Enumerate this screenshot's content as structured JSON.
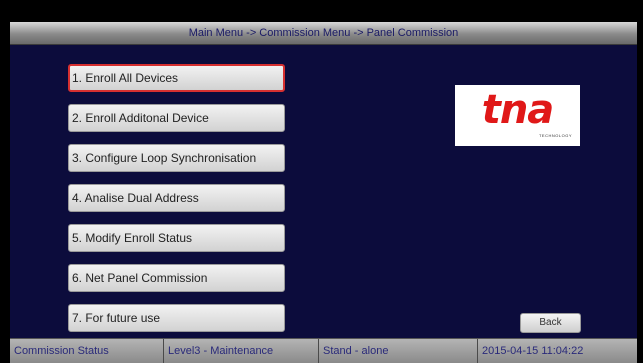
{
  "header": {
    "breadcrumb": "Main Menu -> Commission Menu -> Panel Commission"
  },
  "menu": {
    "items": [
      {
        "label": "1. Enroll All Devices"
      },
      {
        "label": "2. Enroll Additonal Device"
      },
      {
        "label": "3. Configure Loop Synchronisation"
      },
      {
        "label": "4. Analise Dual Address"
      },
      {
        "label": "5. Modify Enroll Status"
      },
      {
        "label": "6. Net Panel Commission"
      },
      {
        "label": "7. For future use"
      }
    ],
    "selected_index": 0
  },
  "logo": {
    "brand": "tna",
    "tagline": "TECHNOLOGY"
  },
  "back_button": {
    "label": "Back"
  },
  "status_bar": {
    "commission_status": "Commission Status",
    "access_level": "Level3 - Maintenance",
    "mode": "Stand - alone",
    "datetime": "2015-04-15 11:04:22"
  },
  "colors": {
    "background": "#0c0c3c",
    "selected_border": "#d63030",
    "logo_red": "#e01818",
    "status_text": "#2a2a7a"
  }
}
